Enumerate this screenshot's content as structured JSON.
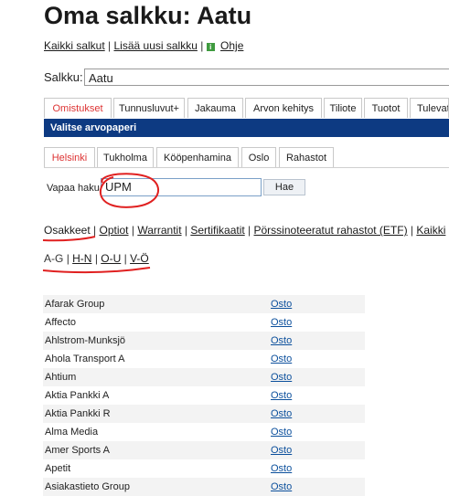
{
  "page": {
    "title": "Oma salkku: Aatu"
  },
  "top_links": {
    "all": "Kaikki salkut",
    "add_new": "Lisää uusi salkku",
    "help": "Ohje"
  },
  "portfolio": {
    "label": "Salkku:",
    "value": "Aatu"
  },
  "main_tabs": [
    {
      "label": "Omistukset",
      "active": true
    },
    {
      "label": "Tunnusluvut+"
    },
    {
      "label": "Jakauma"
    },
    {
      "label": "Arvon kehitys"
    },
    {
      "label": "Tiliote"
    },
    {
      "label": "Tuotot"
    },
    {
      "label": "Tulevat"
    }
  ],
  "panel": {
    "header": "Valitse arvopaperi"
  },
  "market_tabs": [
    {
      "label": "Helsinki",
      "active": true
    },
    {
      "label": "Tukholma"
    },
    {
      "label": "Kööpenhamina"
    },
    {
      "label": "Oslo"
    },
    {
      "label": "Rahastot"
    }
  ],
  "search": {
    "label": "Vapaa haku:",
    "value": "UPM",
    "button": "Hae"
  },
  "categories": {
    "current": "Osakkeet",
    "links": [
      "Optiot",
      "Warrantit",
      "Sertifikaatit",
      "Pörssinoteeratut rahastot (ETF)",
      "Kaikki"
    ]
  },
  "letter_ranges": {
    "current": "A-G",
    "links": [
      "H-N",
      "O-U",
      "V-Ö"
    ]
  },
  "securities": [
    {
      "name": "Afarak Group",
      "action": "Osto"
    },
    {
      "name": "Affecto",
      "action": "Osto"
    },
    {
      "name": "Ahlstrom-Munksjö",
      "action": "Osto"
    },
    {
      "name": "Ahola Transport A",
      "action": "Osto"
    },
    {
      "name": "Ahtium",
      "action": "Osto"
    },
    {
      "name": "Aktia Pankki A",
      "action": "Osto"
    },
    {
      "name": "Aktia Pankki R",
      "action": "Osto"
    },
    {
      "name": "Alma Media",
      "action": "Osto"
    },
    {
      "name": "Amer Sports A",
      "action": "Osto"
    },
    {
      "name": "Apetit",
      "action": "Osto"
    },
    {
      "name": "Asiakastieto Group",
      "action": "Osto"
    }
  ],
  "colors": {
    "header_bar": "#0d3a82",
    "active_tab_text": "#dd3333",
    "annotation_red": "#e02020",
    "link_blue": "#0b4f9c"
  }
}
